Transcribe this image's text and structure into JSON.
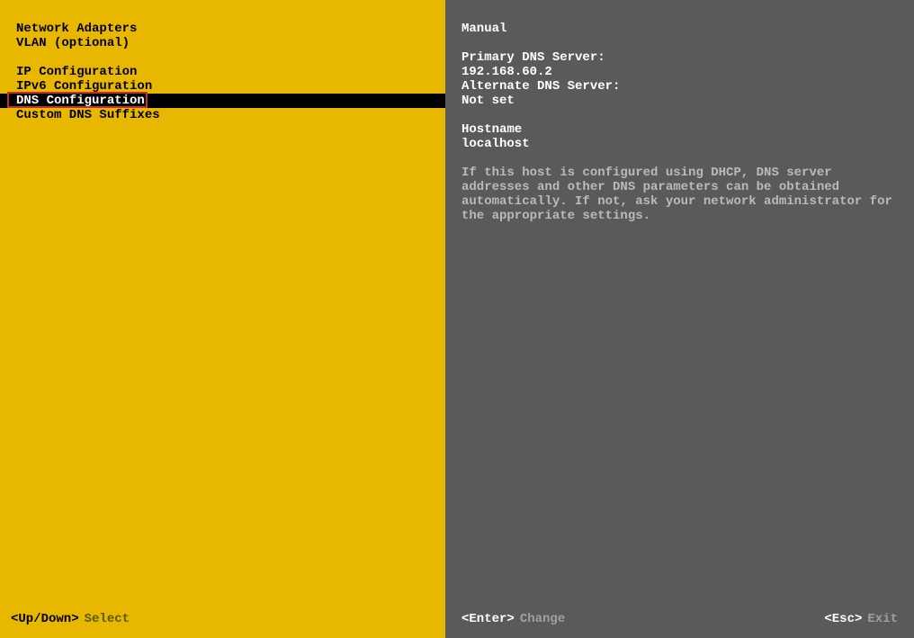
{
  "menu": {
    "group1": [
      "Network Adapters",
      "VLAN (optional)"
    ],
    "group2": [
      "IP Configuration",
      "IPv6 Configuration",
      "DNS Configuration",
      "Custom DNS Suffixes"
    ],
    "selectedIndex": 2
  },
  "details": {
    "mode": "Manual",
    "primary_label": "Primary DNS Server:",
    "primary_value": "192.168.60.2",
    "alternate_label": "Alternate DNS Server:",
    "alternate_value": "Not set",
    "hostname_label": "Hostname",
    "hostname_value": "localhost",
    "help": "If this host is configured using DHCP, DNS server addresses and other DNS parameters can be obtained automatically. If not, ask your network administrator for the appropriate settings."
  },
  "footer": {
    "left_key": "<Up/Down>",
    "left_action": "Select",
    "enter_key": "<Enter>",
    "enter_action": "Change",
    "esc_key": "<Esc>",
    "esc_action": "Exit"
  }
}
